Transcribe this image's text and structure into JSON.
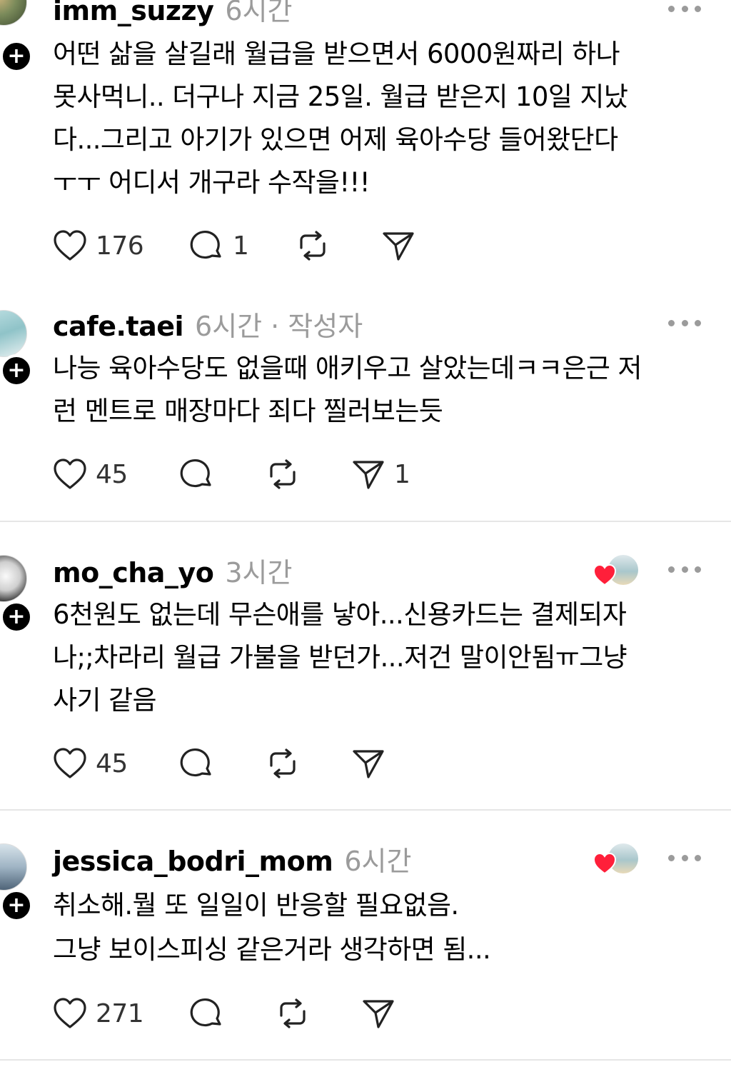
{
  "posts": [
    {
      "username": "imm_suzzy",
      "time": "6시간",
      "author_tag": "",
      "lines": [
        "어떤 삶을 살길래 월급을 받으면서 6000원짜리 하나",
        "못사먹니.. 더구나 지금 25일. 월급 받은지 10일 지났",
        "다...그리고 아기가 있으면 어제 육아수당 들어왔단다",
        "ㅜㅜ  어디서 개구라 수작을!!!"
      ],
      "likes": "176",
      "comments": "1",
      "reposts": "",
      "shares": ""
    },
    {
      "username": "cafe.taei",
      "time": "6시간",
      "author_tag": "· 작성자",
      "lines": [
        "나능 육아수당도 없을때 애키우고 살았는데ㅋㅋ은근 저",
        "런 멘트로 매장마다 죄다 찔러보는듯"
      ],
      "likes": "45",
      "comments": "",
      "reposts": "",
      "shares": "1"
    },
    {
      "username": "mo_cha_yo",
      "time": "3시간",
      "author_tag": "",
      "lines": [
        "6천원도 없는데 무슨애를 낳아...신용카드는 결제되자",
        "나;;차라리 월급 가불을 받던가...저건 말이안됨ㅠ그냥",
        "사기 같음"
      ],
      "likes": "45",
      "comments": "",
      "reposts": "",
      "shares": ""
    },
    {
      "username": "jessica_bodri_mom",
      "time": "6시간",
      "author_tag": "",
      "lines": [
        "취소해.뭘 또 일일이 반응할 필요없음.",
        "그냥 보이스피싱 같은거라 생각하면 됨..."
      ],
      "likes": "271",
      "comments": "",
      "reposts": "",
      "shares": ""
    }
  ],
  "icons": {
    "like": "heart-outline-icon",
    "comment": "speech-bubble-icon",
    "repost": "repost-arrows-icon",
    "share": "paper-plane-icon",
    "more": "more-dots-icon",
    "follow": "plus-icon",
    "liked_by_author": "red-heart-icon"
  },
  "colors": {
    "text": "#000000",
    "meta": "#9b9b9b",
    "divider": "#e6e6e6",
    "heart_red": "#ff1f3a"
  }
}
